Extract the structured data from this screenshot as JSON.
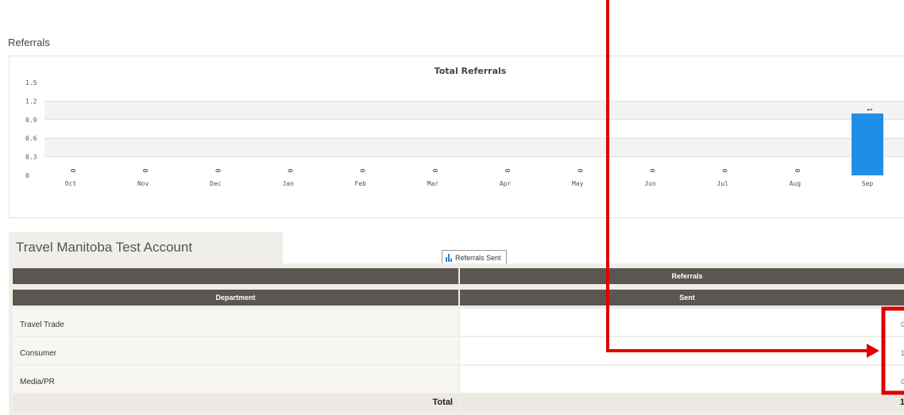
{
  "section": {
    "title": "Referrals"
  },
  "chart_data": {
    "type": "bar",
    "title": "Total Referrals",
    "categories": [
      "Oct",
      "Nov",
      "Dec",
      "Jan",
      "Feb",
      "Mar",
      "Apr",
      "May",
      "Jun",
      "Jul",
      "Aug",
      "Sep"
    ],
    "series": [
      {
        "name": "Referrals Sent",
        "values": [
          0,
          0,
          0,
          0,
          0,
          0,
          0,
          0,
          0,
          0,
          0,
          1
        ],
        "color": "#1f8fe6"
      }
    ],
    "yticks": [
      "0",
      "0.3",
      "0.6",
      "0.9",
      "1.2",
      "1.5"
    ],
    "ylim": [
      0,
      1.5
    ],
    "grid": true,
    "legend": "bottom-center",
    "data_labels": true
  },
  "account": {
    "name": "Travel Manitoba Test Account"
  },
  "table": {
    "group_header": "Referrals",
    "col_department": "Department",
    "col_sent": "Sent",
    "rows": [
      {
        "department": "Travel Trade",
        "sent": "0"
      },
      {
        "department": "Consumer",
        "sent": "1"
      },
      {
        "department": "Media/PR",
        "sent": "0"
      }
    ],
    "total_label": "Total",
    "total_value": "1"
  },
  "colors": {
    "bar": "#1f8fe6",
    "header_bg": "#5b5750",
    "link": "#3a86c8",
    "annotation": "#e00000"
  }
}
